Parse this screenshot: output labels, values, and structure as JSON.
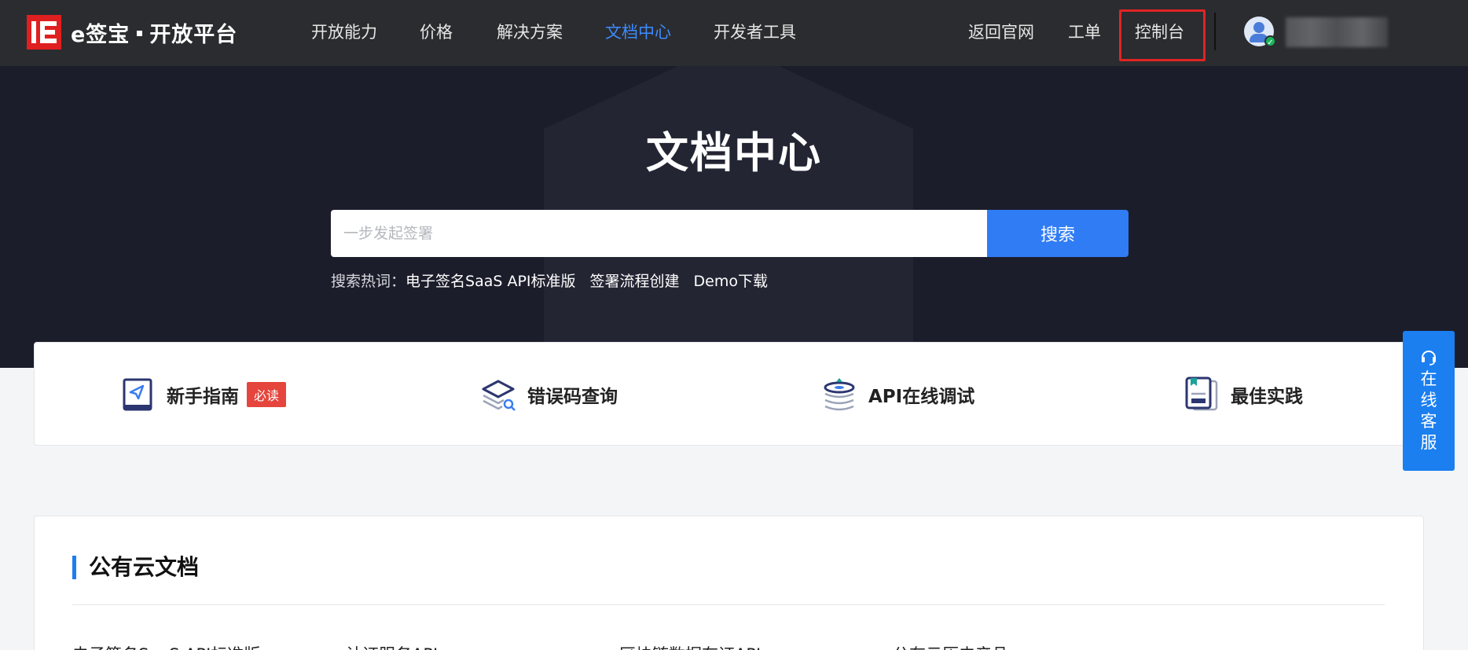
{
  "brand": {
    "name": "e签宝",
    "sub": "开放平台",
    "color": "#e02020"
  },
  "nav": {
    "items": [
      {
        "label": "开放能力",
        "active": false
      },
      {
        "label": "价格",
        "active": false
      },
      {
        "label": "解决方案",
        "active": false
      },
      {
        "label": "文档中心",
        "active": true
      },
      {
        "label": "开发者工具",
        "active": false
      }
    ],
    "right": [
      {
        "label": "返回官网"
      },
      {
        "label": "工单"
      },
      {
        "label": "控制台",
        "highlighted": true
      }
    ],
    "active_color": "#3d8bff"
  },
  "hero": {
    "title": "文档中心",
    "search_placeholder": "一步发起签署",
    "search_button": "搜索",
    "hot_label": "搜索热词：",
    "hot_words": [
      "电子签名SaaS API标准版",
      "签署流程创建",
      "Demo下载"
    ]
  },
  "quick": [
    {
      "label": "新手指南",
      "badge": "必读",
      "icon": "guide-book-icon"
    },
    {
      "label": "错误码查询",
      "icon": "error-code-search-icon"
    },
    {
      "label": "API在线调试",
      "icon": "api-debug-icon"
    },
    {
      "label": "最佳实践",
      "icon": "best-practice-doc-icon"
    }
  ],
  "service": {
    "label": "在线客服",
    "chars": [
      "在",
      "线",
      "客",
      "服"
    ],
    "icon": "headset-icon",
    "color": "#1b7ff0"
  },
  "section": {
    "title": "公有云文档",
    "links": [
      "电子签名SaaS API标准版",
      "认证服务API",
      "区块链数据存证API",
      "公有云历史产品"
    ]
  }
}
